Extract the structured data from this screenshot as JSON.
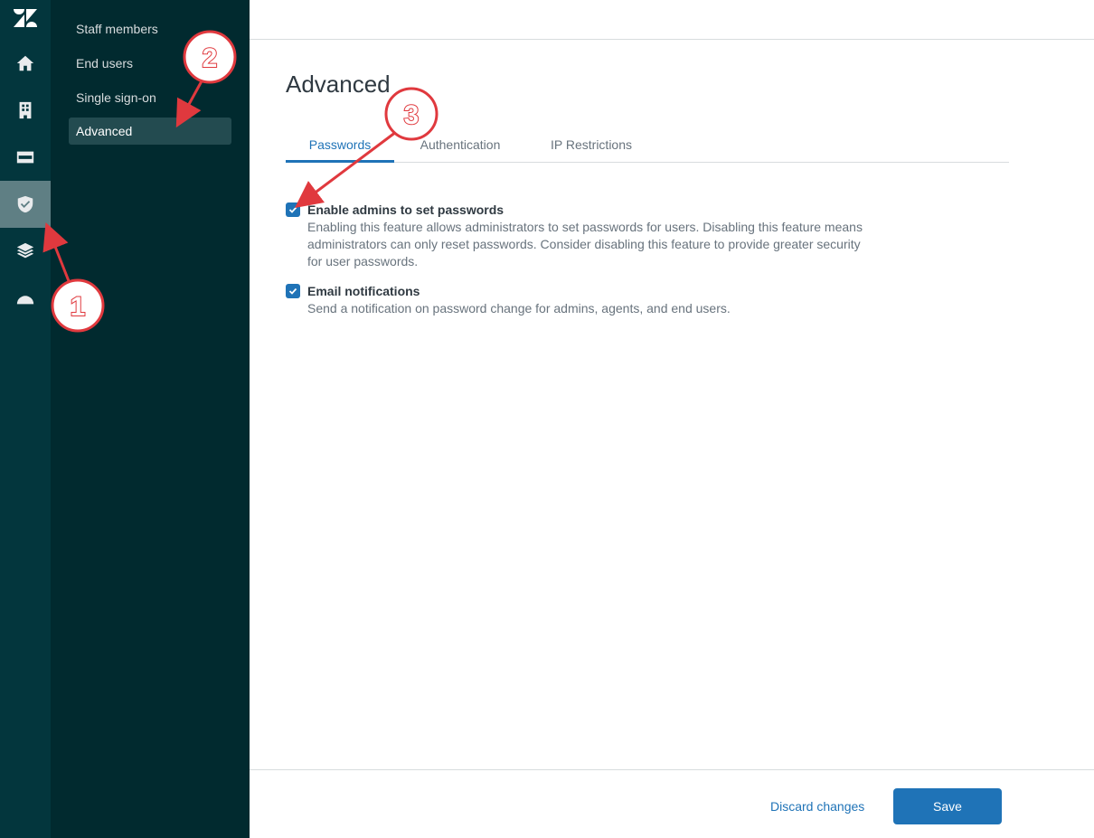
{
  "subnav": {
    "items": [
      {
        "label": "Staff members"
      },
      {
        "label": "End users"
      },
      {
        "label": "Single sign-on"
      },
      {
        "label": "Advanced"
      }
    ]
  },
  "main": {
    "title": "Advanced",
    "tabs": [
      {
        "label": "Passwords",
        "active": true
      },
      {
        "label": "Authentication",
        "active": false
      },
      {
        "label": "IP Restrictions",
        "active": false
      }
    ],
    "options": [
      {
        "label": "Enable admins to set passwords",
        "checked": true,
        "description": "Enabling this feature allows administrators to set passwords for users. Disabling this feature means administrators can only reset passwords. Consider disabling this feature to provide greater security for user passwords."
      },
      {
        "label": "Email notifications",
        "checked": true,
        "description": "Send a notification on password change for admins, agents, and end users."
      }
    ]
  },
  "footer": {
    "discard_label": "Discard changes",
    "save_label": "Save"
  },
  "annotations": {
    "markers": [
      "1",
      "2",
      "3"
    ]
  },
  "rail": {
    "icons": [
      "zendesk-logo-icon",
      "home-icon",
      "building-icon",
      "card-icon",
      "shield-check-icon",
      "layers-icon",
      "half-circle-icon"
    ]
  },
  "colors": {
    "rail_bg": "#03363d",
    "subnav_bg": "#012a2f",
    "accent": "#1f73b7",
    "annotation": "#e0393e"
  }
}
